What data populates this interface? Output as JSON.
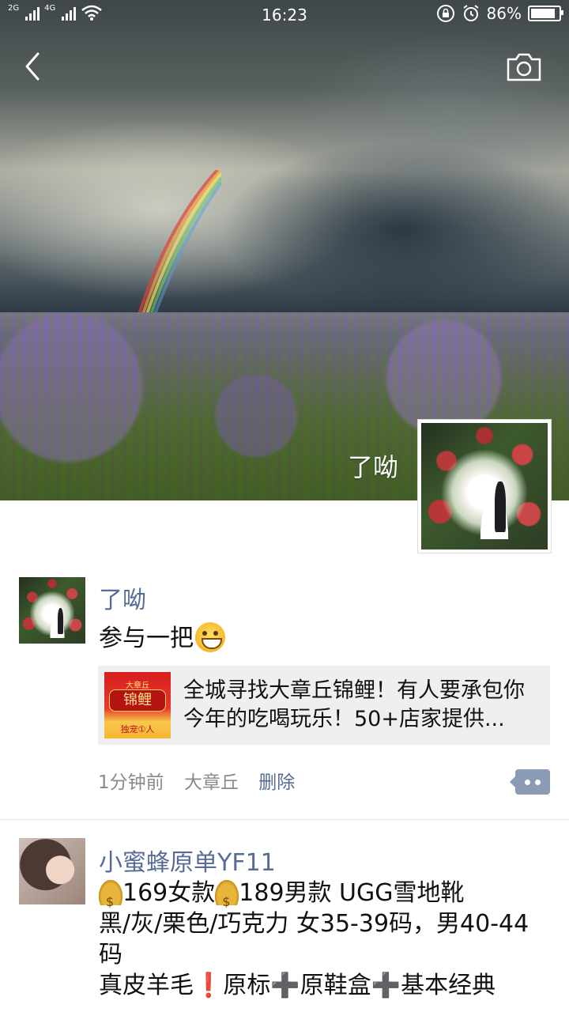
{
  "status_bar": {
    "network_a": "2G",
    "network_b": "4G",
    "time": "16:23",
    "battery": "86%"
  },
  "cover": {
    "name": "了呦"
  },
  "posts": [
    {
      "author": "了呦",
      "text": "参与一把",
      "emoji": "grinning-face",
      "share": {
        "thumb_top": "大章丘",
        "thumb_main": "锦鲤",
        "thumb_bottom": "独宠①人",
        "title": "全城寻找大章丘锦鲤！有人要承包你今年的吃喝玩乐！50+店家提供..."
      },
      "time": "1分钟前",
      "location": "大章丘",
      "delete": "删除"
    },
    {
      "author": "小蜜蜂原单YF11",
      "line1_a": "169女款",
      "line1_b": "189男款 UGG雪地靴",
      "line2": "黑/灰/栗色/巧克力 女35-39码，男40-44码",
      "line3_a": "真皮羊毛",
      "line3_b": "原标",
      "line3_c": "原鞋盒",
      "line3_d": "基本经典"
    }
  ]
}
